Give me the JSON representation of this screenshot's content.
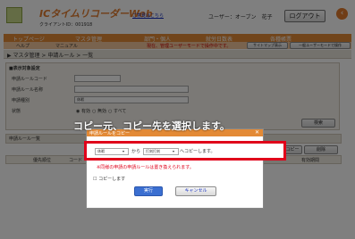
{
  "header": {
    "logo_text": "ICタイムリコーダーWeb",
    "client_id": "クライアントID：001918",
    "help_link": "ご意見はこちら",
    "user_label": "ユーザー：オーブン　花子",
    "logout": "ログアウト"
  },
  "menu": {
    "items": [
      "トップページ",
      "マスタ管理",
      "部門・個人",
      "就労日数表",
      "各種帳票"
    ],
    "sub_items": [
      "ヘルプ",
      "マニュアル"
    ],
    "notice": "現在、管理ユーザーモードで操作中です。",
    "buttons": [
      "サイトマップ表示",
      "一般ユーザーモードで操作"
    ]
  },
  "breadcrumb": "▶ マスタ管理 > 申請ルール > 一覧",
  "search": {
    "section_title": "■表示対象設定",
    "fields": [
      "申請ルールコード",
      "申請ルール名称",
      "申請種別",
      "状態"
    ],
    "type_value": "休暇",
    "status_options": [
      "有効",
      "無効",
      "すべて"
    ],
    "search_button": "検索"
  },
  "list": {
    "title": "申請ルール一覧",
    "copy_button": "ルールをコピー",
    "delete_button": "削除",
    "columns": [
      "優先順位",
      "コード",
      "有効期間"
    ]
  },
  "dialog": {
    "title": "申請ルールをコピー",
    "caption": "コピー元、コピー先を選択します。",
    "source_value": "休暇",
    "from_text": "から",
    "target_value": "打刻打刻",
    "copy_to_text": "へコピーします。",
    "warning": "※同様の申請の申請ルールは置き換えられます。",
    "checkbox_label": "コピーします",
    "execute_button": "実行",
    "cancel_button": "キャンセル"
  },
  "colors": {
    "accent": "#e17a2d",
    "highlight": "#e0001a",
    "overlay": "#000000"
  }
}
